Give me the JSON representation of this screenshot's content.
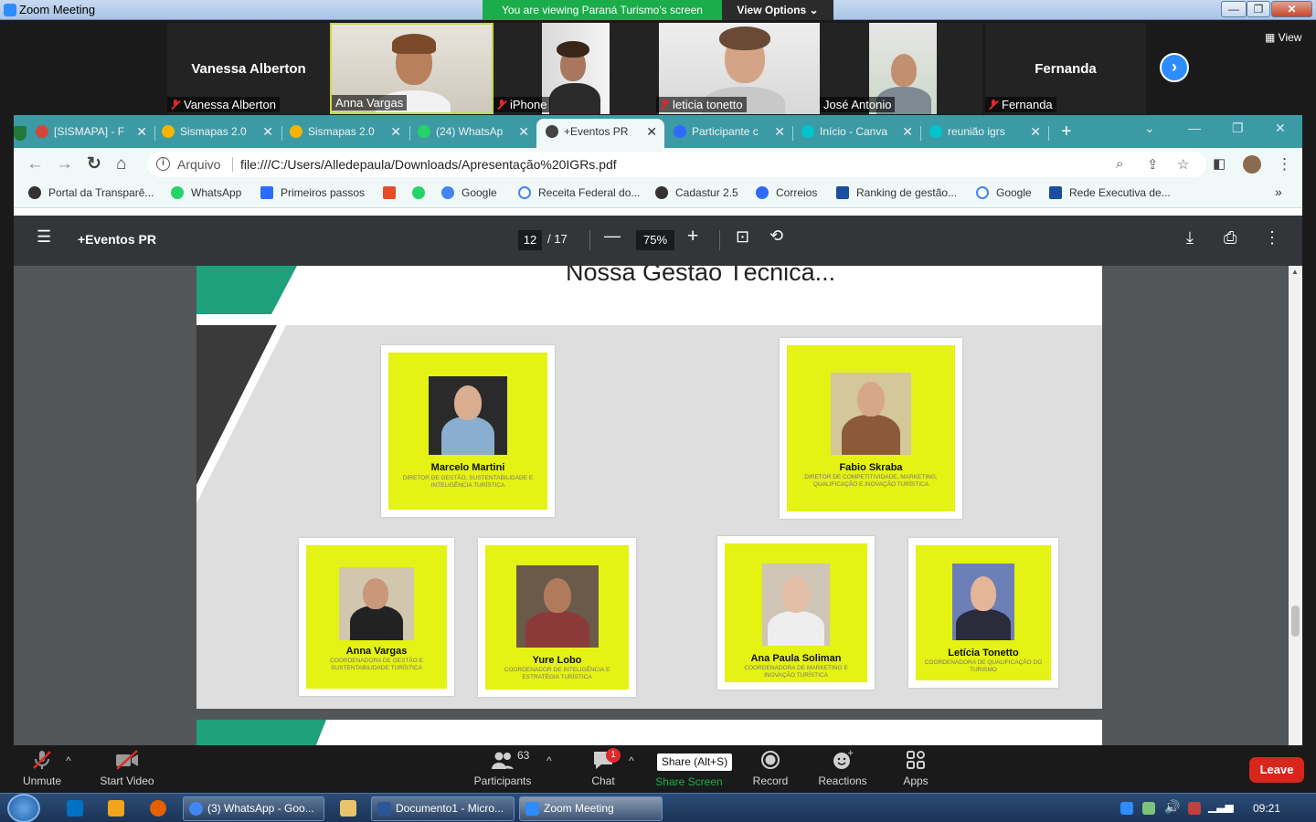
{
  "window": {
    "title": "Zoom Meeting",
    "viewing_banner": "You are viewing Paraná Turismo's screen",
    "view_options": "View Options ⌄",
    "min": "—",
    "max": "❐",
    "close": "✕"
  },
  "gallery": {
    "view_label": "View",
    "tiles": [
      {
        "display": "Vanessa Alberton",
        "name": "Vanessa Alberton",
        "muted": true
      },
      {
        "name": "Anna Vargas",
        "muted": false
      },
      {
        "name": "iPhone",
        "muted": true
      },
      {
        "name": "leticia tonetto",
        "muted": true
      },
      {
        "name": "José Antonio",
        "muted": false
      },
      {
        "display": "Fernanda",
        "name": "Fernanda",
        "muted": true
      }
    ]
  },
  "browser": {
    "tabs": [
      {
        "label": "[SISMAPA] - F",
        "color": "#d44638"
      },
      {
        "label": "Sismapas 2.0",
        "color": "#f4b400"
      },
      {
        "label": "Sismapas 2.0",
        "color": "#f4b400"
      },
      {
        "label": "(24) WhatsAp",
        "color": "#25d366"
      },
      {
        "label": "+Eventos PR",
        "color": "#444444"
      },
      {
        "label": "Participante c",
        "color": "#2d6bff"
      },
      {
        "label": "Início - Canva",
        "color": "#00c4cc"
      },
      {
        "label": "reunião igrs ",
        "color": "#00c4cc"
      }
    ],
    "new_tab": "+",
    "address": {
      "scheme_label": "Arquivo",
      "url": "file:///C:/Users/Alledepaula/Downloads/Apresentação%20IGRs.pdf"
    },
    "bookmarks": [
      {
        "label": "Portal da Transparê...",
        "color": "#333333"
      },
      {
        "label": "WhatsApp",
        "color": "#25d366"
      },
      {
        "label": "Primeiros passos",
        "color": "#2d6bff"
      },
      {
        "label": "",
        "color": "#e44d26"
      },
      {
        "label": "",
        "color": "#25d366"
      },
      {
        "label": "Google",
        "color": "#4285f4"
      },
      {
        "label": "Receita Federal do...",
        "color": "#4285f4"
      },
      {
        "label": "Cadastur 2.5",
        "color": "#333333"
      },
      {
        "label": "Correios",
        "color": "#2d6bff"
      },
      {
        "label": "Ranking de gestão...",
        "color": "#1a4fa0"
      },
      {
        "label": "Google",
        "color": "#4285f4"
      },
      {
        "label": "Rede Executiva de...",
        "color": "#1a4fa0"
      }
    ],
    "more_bookmarks": "»"
  },
  "pdf": {
    "title": "+Eventos PR",
    "page": "12",
    "total": "/ 17",
    "zoom": "75%"
  },
  "slide": {
    "title": "Nossa Gestão Técnica...",
    "people": [
      {
        "name": "Marcelo Martini",
        "role": "Diretor de Gestão, Sustentabilidade e Inteligência Turística"
      },
      {
        "name": "Fabio Skraba",
        "role": "Diretor de Competitividade, Marketing, Qualificação e Inovação Turística"
      },
      {
        "name": "Anna Vargas",
        "role": "Coordenadora de Gestão e Sustentabilidade Turística"
      },
      {
        "name": "Yure Lobo",
        "role": "Coordenador de Inteligência e Estratégia Turística"
      },
      {
        "name": "Ana Paula Soliman",
        "role": "Coordenadora de Marketing e Inovação Turística"
      },
      {
        "name": "Letícia Tonetto",
        "role": "Coordenadora de Qualificação do Turismo"
      }
    ]
  },
  "toolbar": {
    "unmute": "Unmute",
    "start_video": "Start Video",
    "participants": "Participants",
    "participants_count": "63",
    "chat": "Chat",
    "chat_badge": "1",
    "share_tip": "Share (Alt+S)",
    "share": "Share Screen",
    "record": "Record",
    "reactions": "Reactions",
    "apps": "Apps",
    "leave": "Leave"
  },
  "taskbar": {
    "tasks": [
      {
        "label": "(3) WhatsApp - Goo...",
        "color": "#4285f4"
      },
      {
        "label": "Documento1 - Micro...",
        "color": "#2b579a"
      },
      {
        "label": "Zoom Meeting",
        "color": "#2d8cff"
      }
    ],
    "clock": "09:21"
  }
}
